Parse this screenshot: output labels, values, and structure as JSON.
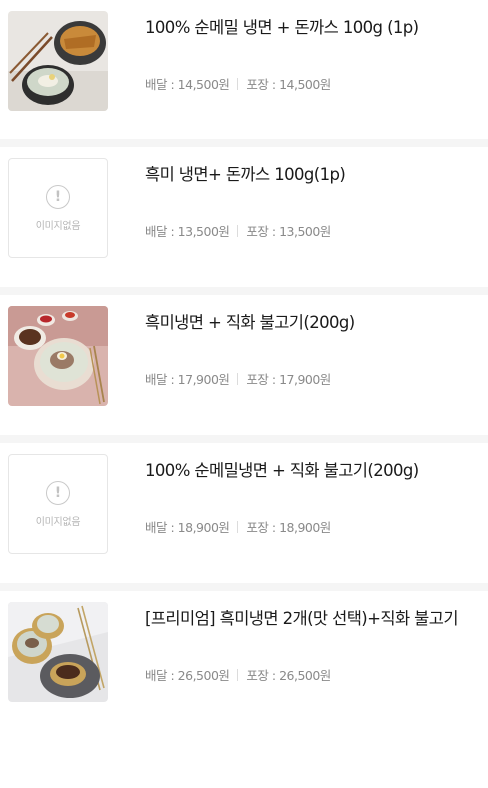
{
  "placeholder_text": "이미지없음",
  "placeholder_icon": "exclamation-circle-icon",
  "items": [
    {
      "name": "100% 순메밀 냉면 + 돈까스 100g (1p)",
      "delivery": "배달 : 14,500원",
      "pickup": "포장 : 14,500원",
      "image": "photo"
    },
    {
      "name": "흑미 냉면+ 돈까스 100g(1p)",
      "delivery": "배달 : 13,500원",
      "pickup": "포장 : 13,500원",
      "image": "none"
    },
    {
      "name": "흑미냉면 + 직화 불고기(200g)",
      "delivery": "배달 : 17,900원",
      "pickup": "포장 : 17,900원",
      "image": "photo"
    },
    {
      "name": "100% 순메밀냉면 + 직화 불고기(200g)",
      "delivery": "배달 : 18,900원",
      "pickup": "포장 : 18,900원",
      "image": "none"
    },
    {
      "name": "[프리미엄] 흑미냉면 2개(맛 선택)+직화 불고기",
      "delivery": "배달 : 26,500원",
      "pickup": "포장 : 26,500원",
      "image": "photo"
    }
  ]
}
